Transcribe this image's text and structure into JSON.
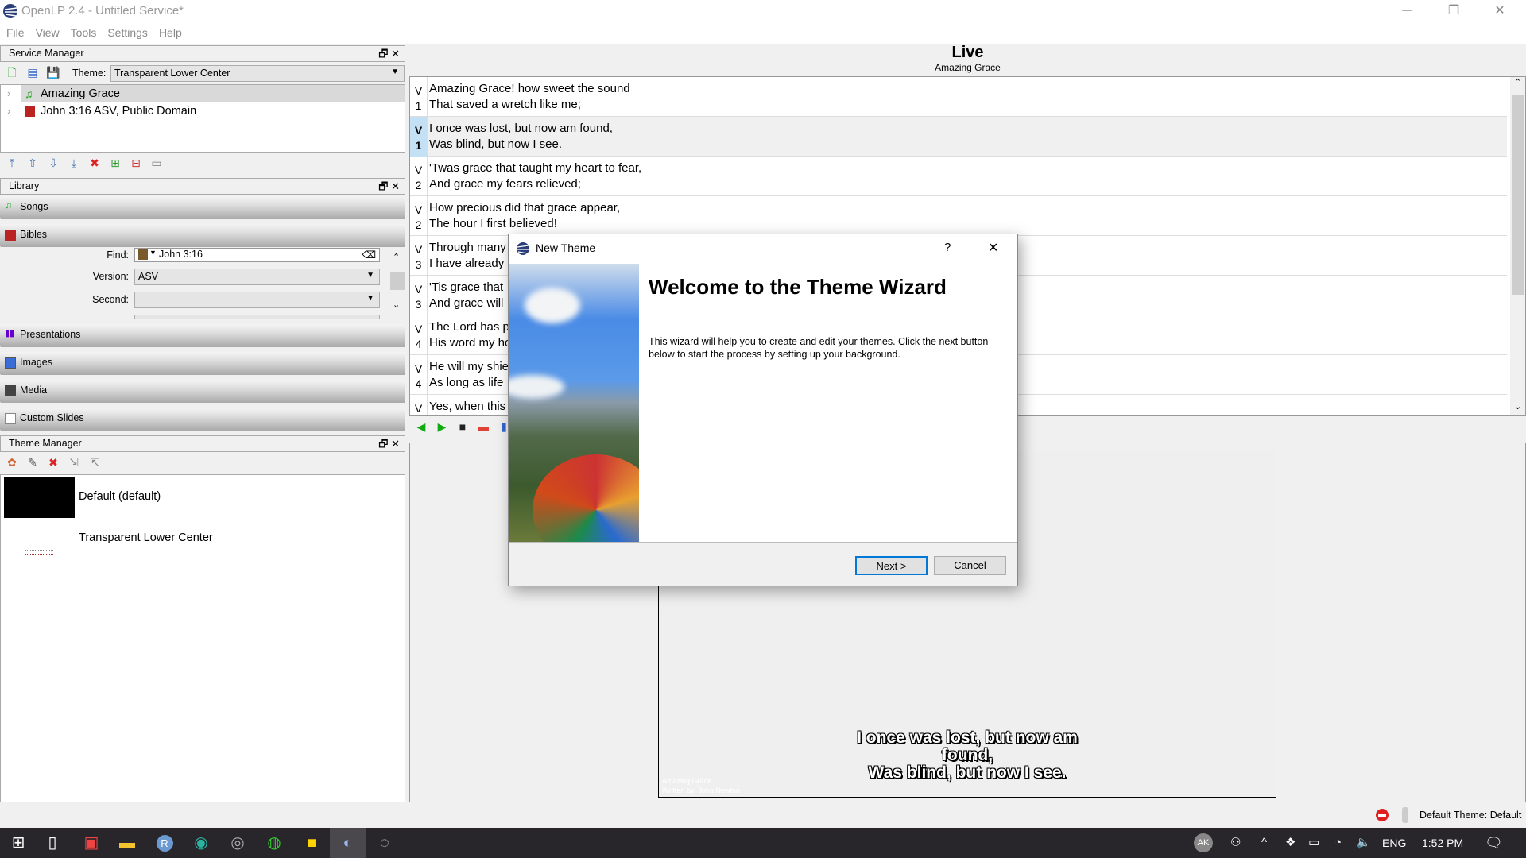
{
  "window": {
    "title": "OpenLP 2.4 - Untitled Service*",
    "minimize": "─",
    "restore": "❐",
    "close": "✕"
  },
  "menu": [
    "File",
    "View",
    "Tools",
    "Settings",
    "Help"
  ],
  "service_manager": {
    "title": "Service Manager",
    "theme_label": "Theme:",
    "theme_value": "Transparent Lower Center",
    "items": [
      "Amazing Grace",
      "John 3:16 ASV, Public Domain"
    ]
  },
  "library": {
    "title": "Library",
    "sections": [
      "Songs",
      "Bibles",
      "Presentations",
      "Images",
      "Media",
      "Custom Slides"
    ],
    "bibles": {
      "find_label": "Find:",
      "find_value": "John 3:16",
      "version_label": "Version:",
      "version_value": "ASV",
      "second_label": "Second:",
      "second_value": ""
    }
  },
  "theme_manager": {
    "title": "Theme Manager",
    "themes": [
      "Default (default)",
      "Transparent Lower Center"
    ]
  },
  "live": {
    "title": "Live",
    "subtitle": "Amazing Grace",
    "rows": [
      {
        "tag": [
          "V",
          "1"
        ],
        "lines": [
          "Amazing Grace! how sweet the sound",
          "That saved a wretch like me;"
        ]
      },
      {
        "tag": [
          "V",
          "1"
        ],
        "lines": [
          "I once was lost, but now am found,",
          "Was blind, but now I see."
        ],
        "selected": true
      },
      {
        "tag": [
          "V",
          "2"
        ],
        "lines": [
          "'Twas grace that taught my heart to fear,",
          "And grace my fears relieved;"
        ]
      },
      {
        "tag": [
          "V",
          "2"
        ],
        "lines": [
          "How precious did that grace appear,",
          "The hour I first believed!"
        ]
      },
      {
        "tag": [
          "V",
          "3"
        ],
        "lines": [
          "Through many",
          "I have already"
        ]
      },
      {
        "tag": [
          "V",
          "3"
        ],
        "lines": [
          "'Tis grace that",
          "And grace will"
        ]
      },
      {
        "tag": [
          "V",
          "4"
        ],
        "lines": [
          "The Lord has pr",
          "His word my ho"
        ]
      },
      {
        "tag": [
          "V",
          "4"
        ],
        "lines": [
          "He will my shie",
          "As long as life"
        ]
      },
      {
        "tag": [
          "V",
          ""
        ],
        "lines": [
          "Yes, when this h",
          ""
        ]
      }
    ],
    "display_text": [
      "I once was lost, but now am",
      "found,",
      "Was blind, but now I see."
    ],
    "display_footer": [
      "Amazing Grace",
      "Written by: John Newton"
    ]
  },
  "dialog": {
    "title": "New Theme",
    "help": "?",
    "close": "✕",
    "heading": "Welcome to the Theme Wizard",
    "body": "This wizard will help you to create and edit your themes. Click the next button below to start the process by setting up your background.",
    "next": "Next >",
    "cancel": "Cancel"
  },
  "statusbar": {
    "theme": "Default Theme: Default"
  },
  "taskbar": {
    "avatar": "AK",
    "language": "ENG",
    "time": "1:52 PM"
  },
  "colors": {
    "accent": "#0078d7",
    "selected_row": "#c4e0f5",
    "taskbar": "#28262a"
  }
}
